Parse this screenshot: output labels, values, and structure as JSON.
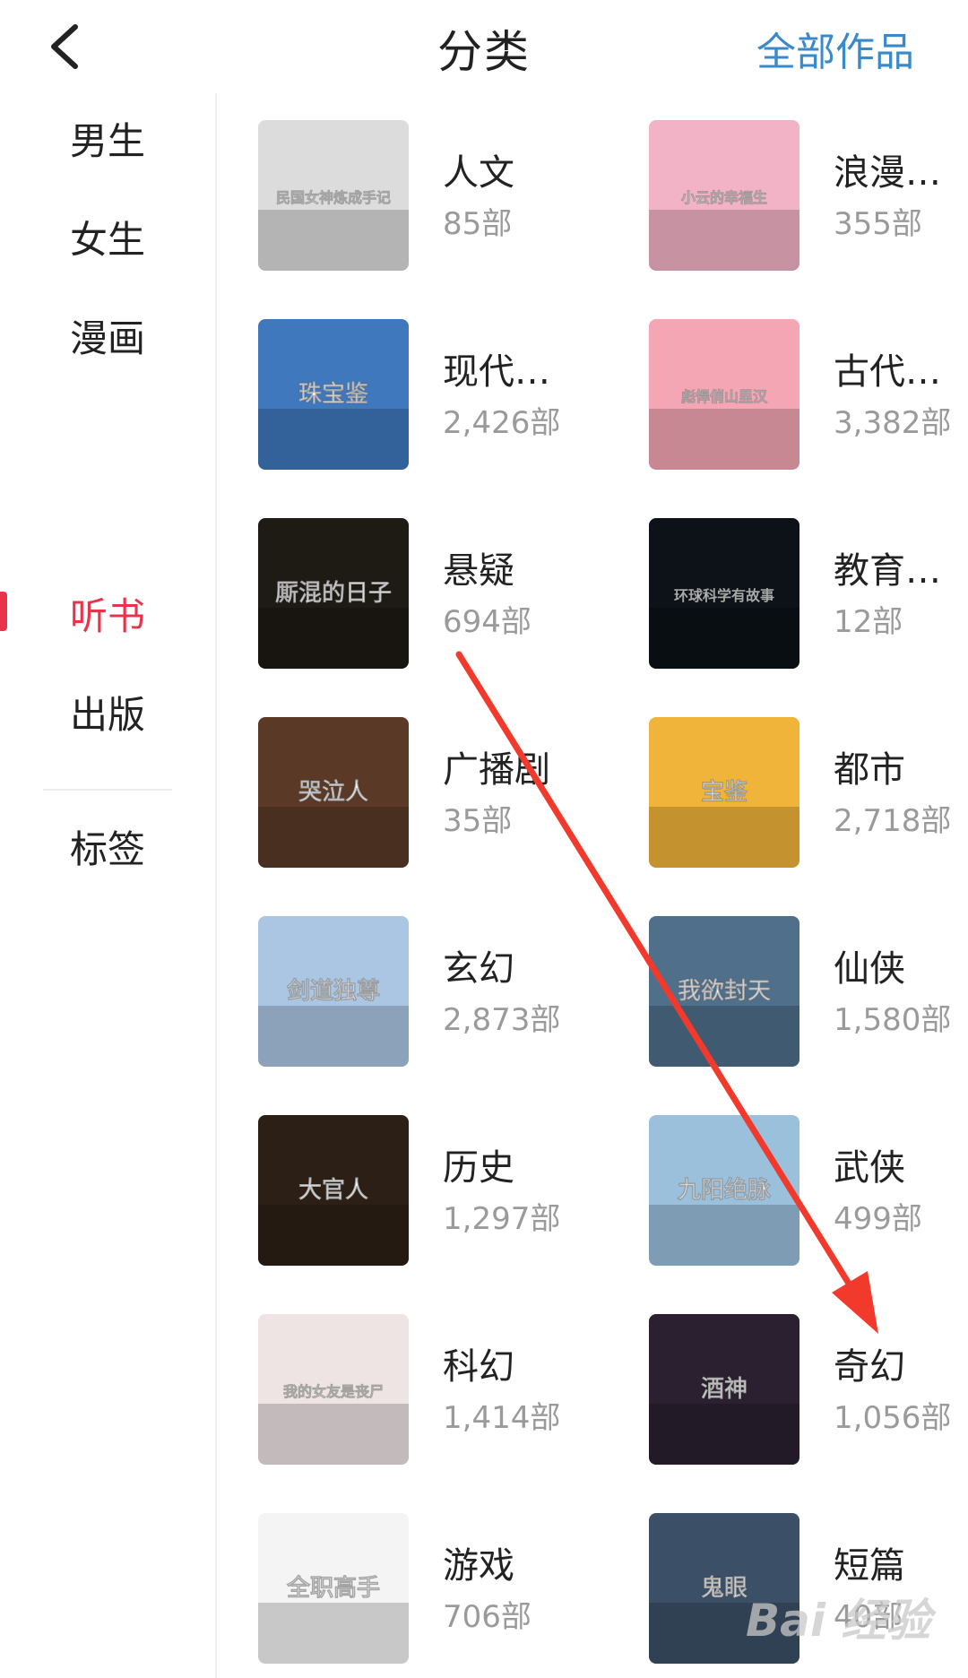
{
  "header": {
    "title": "分类",
    "right_link": "全部作品"
  },
  "sidebar": {
    "items": [
      {
        "label": "男生"
      },
      {
        "label": "女生"
      },
      {
        "label": "漫画"
      },
      {
        "label": "听书",
        "active": true
      },
      {
        "label": "出版"
      },
      {
        "label": "标签"
      }
    ]
  },
  "categories": [
    {
      "name": "人文",
      "count": "85部",
      "cover_color": "#dcdcdc",
      "cover_text": "民国女神炼成手记"
    },
    {
      "name": "浪漫…",
      "count": "355部",
      "cover_color": "#f3b3c6",
      "cover_text": "小云的幸福生"
    },
    {
      "name": "现代…",
      "count": "2,426部",
      "cover_color": "#3f78bd",
      "cover_text": "珠宝鉴"
    },
    {
      "name": "古代…",
      "count": "3,382部",
      "cover_color": "#f4a6b4",
      "cover_text": "彪悍俏山里汉"
    },
    {
      "name": "悬疑",
      "count": "694部",
      "cover_color": "#1e1a14",
      "cover_text": "厮混的日子"
    },
    {
      "name": "教育…",
      "count": "12部",
      "cover_color": "#0c1218",
      "cover_text": "环球科学有故事"
    },
    {
      "name": "广播剧",
      "count": "35部",
      "cover_color": "#5a3a26",
      "cover_text": "哭泣人"
    },
    {
      "name": "都市",
      "count": "2,718部",
      "cover_color": "#f0b43a",
      "cover_text": "宝鉴"
    },
    {
      "name": "玄幻",
      "count": "2,873部",
      "cover_color": "#aac6e3",
      "cover_text": "剑道独尊"
    },
    {
      "name": "仙侠",
      "count": "1,580部",
      "cover_color": "#4f6f8a",
      "cover_text": "我欲封天"
    },
    {
      "name": "历史",
      "count": "1,297部",
      "cover_color": "#2c2016",
      "cover_text": "大官人"
    },
    {
      "name": "武侠",
      "count": "499部",
      "cover_color": "#9ac0dc",
      "cover_text": "九阳绝脉"
    },
    {
      "name": "科幻",
      "count": "1,414部",
      "cover_color": "#eee4e4",
      "cover_text": "我的女友是丧尸"
    },
    {
      "name": "奇幻",
      "count": "1,056部",
      "cover_color": "#2a2030",
      "cover_text": "酒神"
    },
    {
      "name": "游戏",
      "count": "706部",
      "cover_color": "#f4f4f4",
      "cover_text": "全职高手"
    },
    {
      "name": "短篇",
      "count": "40部",
      "cover_color": "#3b5066",
      "cover_text": "鬼眼"
    }
  ],
  "watermark": "Bai 经验"
}
